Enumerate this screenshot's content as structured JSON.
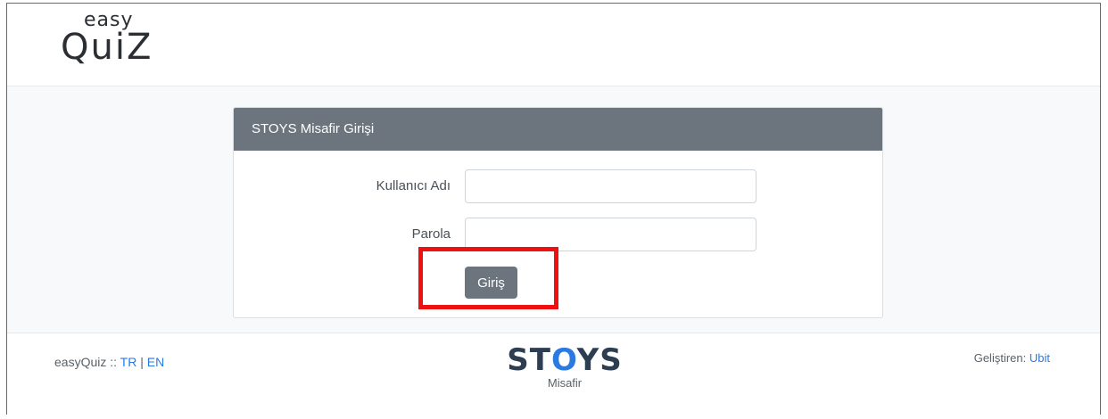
{
  "header": {
    "logo_small": "easy",
    "logo_large": "QuiZ"
  },
  "login_card": {
    "title": "STOYS Misafir Girişi",
    "username_label": "Kullanıcı Adı",
    "username_value": "",
    "password_label": "Parola",
    "password_value": "",
    "submit_label": "Giriş"
  },
  "footer": {
    "app_name": "easyQuiz ::",
    "lang_tr": "TR",
    "lang_separator": "|",
    "lang_en": "EN",
    "brand_prefix": "ST",
    "brand_o": "O",
    "brand_suffix": "YS",
    "brand_sub": "Misafir",
    "developer_label": "Geliştiren:",
    "developer_link": "Ubit"
  },
  "colors": {
    "card_header": "#6c757d",
    "link": "#2a7ae2",
    "highlight": "#ee1111"
  }
}
